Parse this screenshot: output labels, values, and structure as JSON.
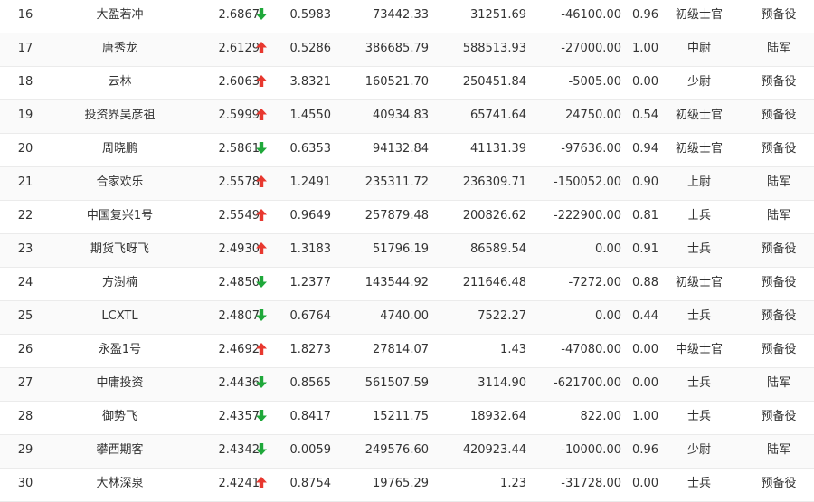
{
  "colors": {
    "up": "#e8382f",
    "down": "#1fa83a"
  },
  "rows": [
    {
      "rank": "16",
      "name": "大盈若冲",
      "score": "2.6867",
      "trend": "down",
      "trend_icon": "arrow-down-icon",
      "ratio": "0.5983",
      "v1": "73442.33",
      "v2": "31251.69",
      "v3": "-46100.00",
      "v4": "0.96",
      "level": "初级士官",
      "army": "预备役"
    },
    {
      "rank": "17",
      "name": "唐秀龙",
      "score": "2.6129",
      "trend": "up",
      "trend_icon": "arrow-up-icon",
      "ratio": "0.5286",
      "v1": "386685.79",
      "v2": "588513.93",
      "v3": "-27000.00",
      "v4": "1.00",
      "level": "中尉",
      "army": "陆军"
    },
    {
      "rank": "18",
      "name": "云林",
      "score": "2.6063",
      "trend": "up",
      "trend_icon": "arrow-up-icon",
      "ratio": "3.8321",
      "v1": "160521.70",
      "v2": "250451.84",
      "v3": "-5005.00",
      "v4": "0.00",
      "level": "少尉",
      "army": "预备役"
    },
    {
      "rank": "19",
      "name": "投资界吴彦祖",
      "score": "2.5999",
      "trend": "up",
      "trend_icon": "arrow-up-icon",
      "ratio": "1.4550",
      "v1": "40934.83",
      "v2": "65741.64",
      "v3": "24750.00",
      "v4": "0.54",
      "level": "初级士官",
      "army": "预备役"
    },
    {
      "rank": "20",
      "name": "周晓鹏",
      "score": "2.5861",
      "trend": "down",
      "trend_icon": "arrow-down-icon",
      "ratio": "0.6353",
      "v1": "94132.84",
      "v2": "41131.39",
      "v3": "-97636.00",
      "v4": "0.94",
      "level": "初级士官",
      "army": "预备役"
    },
    {
      "rank": "21",
      "name": "合家欢乐",
      "score": "2.5578",
      "trend": "up",
      "trend_icon": "arrow-up-icon",
      "ratio": "1.2491",
      "v1": "235311.72",
      "v2": "236309.71",
      "v3": "-150052.00",
      "v4": "0.90",
      "level": "上尉",
      "army": "陆军"
    },
    {
      "rank": "22",
      "name": "中国复兴1号",
      "score": "2.5549",
      "trend": "up",
      "trend_icon": "arrow-up-icon",
      "ratio": "0.9649",
      "v1": "257879.48",
      "v2": "200826.62",
      "v3": "-222900.00",
      "v4": "0.81",
      "level": "士兵",
      "army": "陆军"
    },
    {
      "rank": "23",
      "name": "期货飞呀飞",
      "score": "2.4930",
      "trend": "up",
      "trend_icon": "arrow-up-icon",
      "ratio": "1.3183",
      "v1": "51796.19",
      "v2": "86589.54",
      "v3": "0.00",
      "v4": "0.91",
      "level": "士兵",
      "army": "预备役"
    },
    {
      "rank": "24",
      "name": "方澍楠",
      "score": "2.4850",
      "trend": "down",
      "trend_icon": "arrow-down-icon",
      "ratio": "1.2377",
      "v1": "143544.92",
      "v2": "211646.48",
      "v3": "-7272.00",
      "v4": "0.88",
      "level": "初级士官",
      "army": "预备役"
    },
    {
      "rank": "25",
      "name": "LCXTL",
      "score": "2.4807",
      "trend": "down",
      "trend_icon": "arrow-down-icon",
      "ratio": "0.6764",
      "v1": "4740.00",
      "v2": "7522.27",
      "v3": "0.00",
      "v4": "0.44",
      "level": "士兵",
      "army": "预备役"
    },
    {
      "rank": "26",
      "name": "永盈1号",
      "score": "2.4692",
      "trend": "up",
      "trend_icon": "arrow-up-icon",
      "ratio": "1.8273",
      "v1": "27814.07",
      "v2": "1.43",
      "v3": "-47080.00",
      "v4": "0.00",
      "level": "中级士官",
      "army": "预备役"
    },
    {
      "rank": "27",
      "name": "中庸投资",
      "score": "2.4436",
      "trend": "down",
      "trend_icon": "arrow-down-icon",
      "ratio": "0.8565",
      "v1": "561507.59",
      "v2": "3114.90",
      "v3": "-621700.00",
      "v4": "0.00",
      "level": "士兵",
      "army": "陆军"
    },
    {
      "rank": "28",
      "name": "御势飞",
      "score": "2.4357",
      "trend": "down",
      "trend_icon": "arrow-down-icon",
      "ratio": "0.8417",
      "v1": "15211.75",
      "v2": "18932.64",
      "v3": "822.00",
      "v4": "1.00",
      "level": "士兵",
      "army": "预备役"
    },
    {
      "rank": "29",
      "name": "攀西期客",
      "score": "2.4342",
      "trend": "down",
      "trend_icon": "arrow-down-icon",
      "ratio": "0.0059",
      "v1": "249576.60",
      "v2": "420923.44",
      "v3": "-10000.00",
      "v4": "0.96",
      "level": "少尉",
      "army": "陆军"
    },
    {
      "rank": "30",
      "name": "大林深泉",
      "score": "2.4241",
      "trend": "up",
      "trend_icon": "arrow-up-icon",
      "ratio": "0.8754",
      "v1": "19765.29",
      "v2": "1.23",
      "v3": "-31728.00",
      "v4": "0.00",
      "level": "士兵",
      "army": "预备役"
    }
  ]
}
